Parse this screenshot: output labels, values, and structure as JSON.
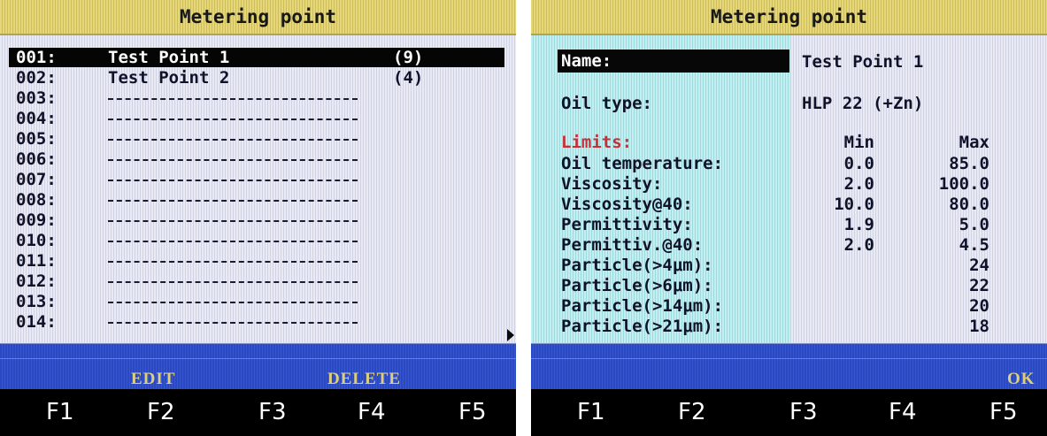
{
  "left": {
    "title": "Metering point",
    "rows": [
      {
        "num": "001:",
        "name": "Test Point 1",
        "count": "(9)"
      },
      {
        "num": "002:",
        "name": "Test Point 2",
        "count": "(4)"
      },
      {
        "num": "003:",
        "name": "",
        "count": ""
      },
      {
        "num": "004:",
        "name": "",
        "count": ""
      },
      {
        "num": "005:",
        "name": "",
        "count": ""
      },
      {
        "num": "006:",
        "name": "",
        "count": ""
      },
      {
        "num": "007:",
        "name": "",
        "count": ""
      },
      {
        "num": "008:",
        "name": "",
        "count": ""
      },
      {
        "num": "009:",
        "name": "",
        "count": ""
      },
      {
        "num": "010:",
        "name": "",
        "count": ""
      },
      {
        "num": "011:",
        "name": "",
        "count": ""
      },
      {
        "num": "012:",
        "name": "",
        "count": ""
      },
      {
        "num": "013:",
        "name": "",
        "count": ""
      },
      {
        "num": "014:",
        "name": "",
        "count": ""
      }
    ],
    "softkeys": {
      "f2": "EDIT",
      "f4": "DELETE"
    },
    "keys": [
      "F1",
      "F2",
      "F3",
      "F4",
      "F5"
    ]
  },
  "right": {
    "title": "Metering point",
    "name_label": "Name:",
    "name_value": "Test Point 1",
    "oil_type_label": "Oil type:",
    "oil_type_value": "HLP 22 (+Zn)",
    "limits_label": "Limits:",
    "min_header": "Min",
    "max_header": "Max",
    "params": [
      {
        "label": "Oil temperature:",
        "min": "0.0",
        "max": "85.0"
      },
      {
        "label": "Viscosity:",
        "min": "2.0",
        "max": "100.0"
      },
      {
        "label": "Viscosity@40:",
        "min": "10.0",
        "max": "80.0"
      },
      {
        "label": "Permittivity:",
        "min": "1.9",
        "max": "5.0"
      },
      {
        "label": "Permittiv.@40:",
        "min": "2.0",
        "max": "4.5"
      },
      {
        "label": "Particle(>4μm):",
        "min": "",
        "max": "24"
      },
      {
        "label": "Particle(>6μm):",
        "min": "",
        "max": "22"
      },
      {
        "label": "Particle(>14μm):",
        "min": "",
        "max": "20"
      },
      {
        "label": "Particle(>21μm):",
        "min": "",
        "max": "18"
      }
    ],
    "softkeys": {
      "f5": "OK"
    },
    "keys": [
      "F1",
      "F2",
      "F3",
      "F4",
      "F5"
    ]
  }
}
